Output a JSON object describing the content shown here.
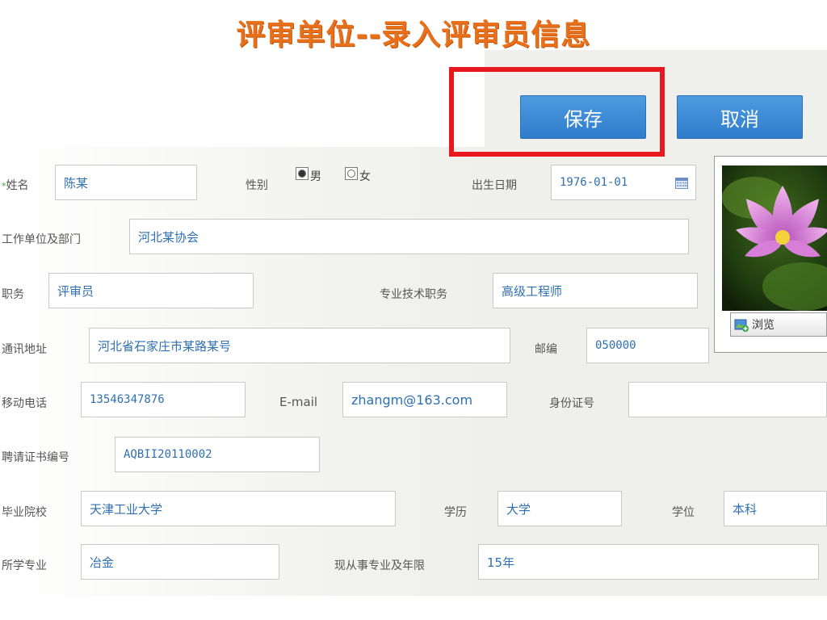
{
  "page": {
    "title": "评审单位--录入评审员信息"
  },
  "toolbar": {
    "save_label": "保存",
    "cancel_label": "取消"
  },
  "photo": {
    "browse_label": "浏览"
  },
  "form": {
    "required_mark": "*",
    "name_label": "姓名",
    "name_value": "陈某",
    "gender_label": "性别",
    "gender_male": "男",
    "gender_female": "女",
    "gender_selected": "男",
    "birth_label": "出生日期",
    "birth_value": "1976-01-01",
    "work_label": "工作单位及部门",
    "work_value": "河北某协会",
    "duty_label": "职务",
    "duty_value": "评审员",
    "title_label": "专业技术职务",
    "title_value": "高级工程师",
    "addr_label": "通讯地址",
    "addr_value": "河北省石家庄市某路某号",
    "zip_label": "邮编",
    "zip_value": "050000",
    "mobile_label": "移动电话",
    "mobile_value": "13546347876",
    "email_label": "E-mail",
    "email_value": "zhangm@163.com",
    "id_label": "身份证号",
    "id_value": "",
    "cert_label": "聘请证书编号",
    "cert_value": "AQBII20110002",
    "school_label": "毕业院校",
    "school_value": "天津工业大学",
    "edu_label": "学历",
    "edu_value": "大学",
    "degree_label": "学位",
    "degree_value": "本科",
    "major_label": "所学专业",
    "major_value": "冶金",
    "years_label": "现从事专业及年限",
    "years_value": "15年"
  }
}
